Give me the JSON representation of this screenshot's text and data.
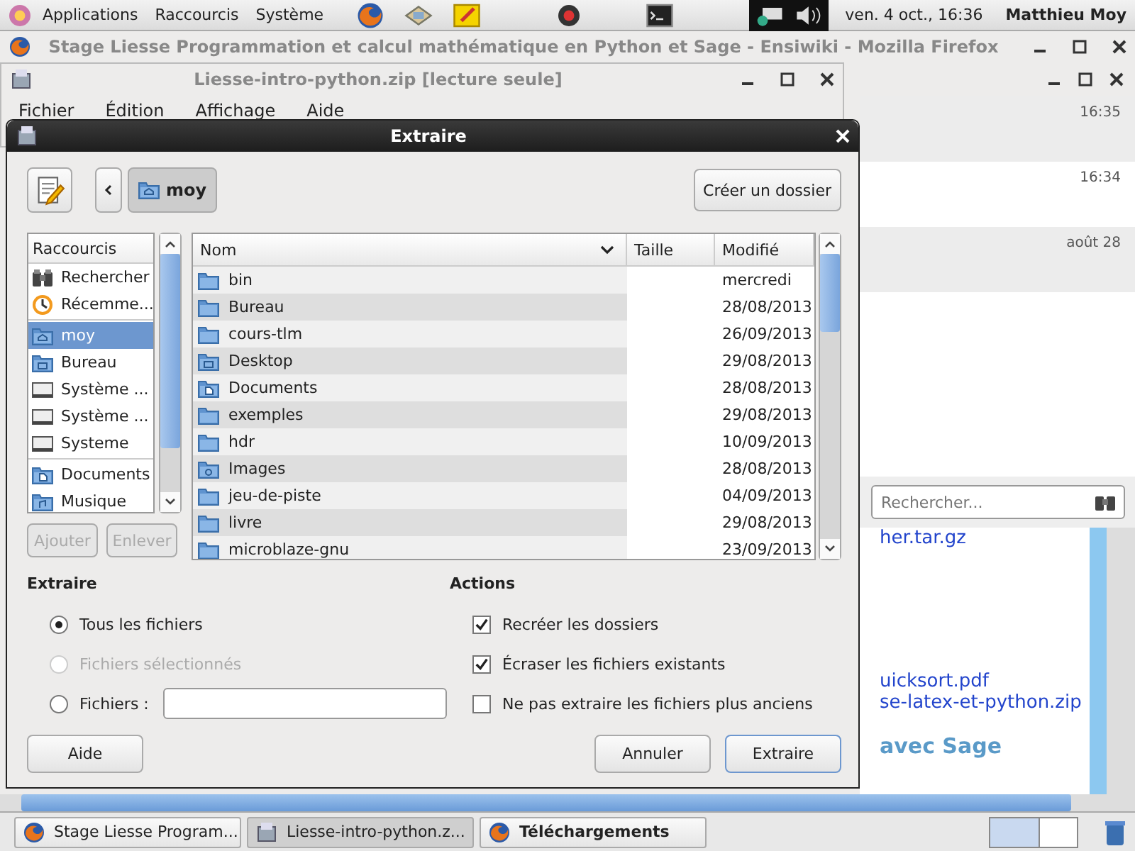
{
  "top_panel": {
    "menus": [
      "Applications",
      "Raccourcis",
      "Système"
    ],
    "clock": "ven.  4 oct., 16:36",
    "user": "Matthieu Moy"
  },
  "browser_window": {
    "title": "Stage Liesse Programmation et calcul mathématique en Python et Sage - Ensiwiki - Mozilla Firefox",
    "times": [
      "16:35",
      "16:34",
      "août 28"
    ],
    "search": {
      "placeholder": "Rechercher..."
    },
    "links": [
      "her.tar.gz",
      "uicksort.pdf",
      "se-latex-et-python.zip"
    ],
    "heading": "avec Sage"
  },
  "archive_window": {
    "title": "Liesse-intro-python.zip [lecture seule]",
    "menu": [
      "Fichier",
      "Édition",
      "Affichage",
      "Aide"
    ]
  },
  "dialog": {
    "title": "Extraire",
    "path_button": "moy",
    "create_folder": "Créer un dossier",
    "places_header": "Raccourcis",
    "places": [
      {
        "label": "Rechercher",
        "kind": "search",
        "selected": false
      },
      {
        "label": "Récemme...",
        "kind": "recent",
        "selected": false
      },
      {
        "label": "moy",
        "kind": "home",
        "selected": true
      },
      {
        "label": "Bureau",
        "kind": "desktop",
        "selected": false
      },
      {
        "label": "Système ...",
        "kind": "drive",
        "selected": false
      },
      {
        "label": "Système ...",
        "kind": "drive",
        "selected": false
      },
      {
        "label": "Systeme",
        "kind": "drive",
        "selected": false
      },
      {
        "label": "Documents",
        "kind": "documents",
        "selected": false
      },
      {
        "label": "Musique",
        "kind": "music",
        "selected": false
      }
    ],
    "places_buttons": [
      {
        "label": "Ajouter",
        "disabled": true
      },
      {
        "label": "Enlever",
        "disabled": true
      }
    ],
    "columns": [
      "Nom",
      "Taille",
      "Modifié"
    ],
    "files": [
      {
        "name": "bin",
        "kind": "folder",
        "modified": "mercredi"
      },
      {
        "name": "Bureau",
        "kind": "folder",
        "modified": "28/08/2013"
      },
      {
        "name": "cours-tlm",
        "kind": "folder",
        "modified": "26/09/2013"
      },
      {
        "name": "Desktop",
        "kind": "desktop",
        "modified": "29/08/2013"
      },
      {
        "name": "Documents",
        "kind": "documents",
        "modified": "28/08/2013"
      },
      {
        "name": "exemples",
        "kind": "folder",
        "modified": "29/08/2013"
      },
      {
        "name": "hdr",
        "kind": "folder",
        "modified": "10/09/2013"
      },
      {
        "name": "Images",
        "kind": "pictures",
        "modified": "28/08/2013"
      },
      {
        "name": "jeu-de-piste",
        "kind": "folder",
        "modified": "04/09/2013"
      },
      {
        "name": "livre",
        "kind": "folder",
        "modified": "29/08/2013"
      },
      {
        "name": "microblaze-gnu",
        "kind": "folder",
        "modified": "23/09/2013"
      }
    ],
    "extract": {
      "title": "Extraire",
      "options": [
        {
          "label": "Tous les fichiers",
          "kind": "plain",
          "selected": true,
          "disabled": false
        },
        {
          "label": "Fichiers sélectionnés",
          "kind": "plain",
          "selected": false,
          "disabled": true
        },
        {
          "label": "Fichiers :",
          "kind": "with-field",
          "selected": false,
          "disabled": false
        }
      ]
    },
    "actions": {
      "title": "Actions",
      "options": [
        {
          "label": "Recréer les dossiers",
          "checked": true
        },
        {
          "label": "Écraser les fichiers existants",
          "checked": true
        },
        {
          "label": "Ne pas extraire les fichiers plus anciens",
          "checked": false
        }
      ]
    },
    "buttons": [
      {
        "label": "Aide",
        "kind": "help",
        "default": false
      },
      {
        "label": "Annuler",
        "kind": "action",
        "default": false
      },
      {
        "label": "Extraire",
        "kind": "action",
        "default": true
      }
    ]
  },
  "taskbar": [
    {
      "label": "Stage Liesse Program...",
      "kind": "firefox",
      "selected": false
    },
    {
      "label": "Liesse-intro-python.z...",
      "kind": "archive",
      "selected": true
    },
    {
      "label": "Téléchargements",
      "kind": "firefox",
      "selected": false
    }
  ]
}
